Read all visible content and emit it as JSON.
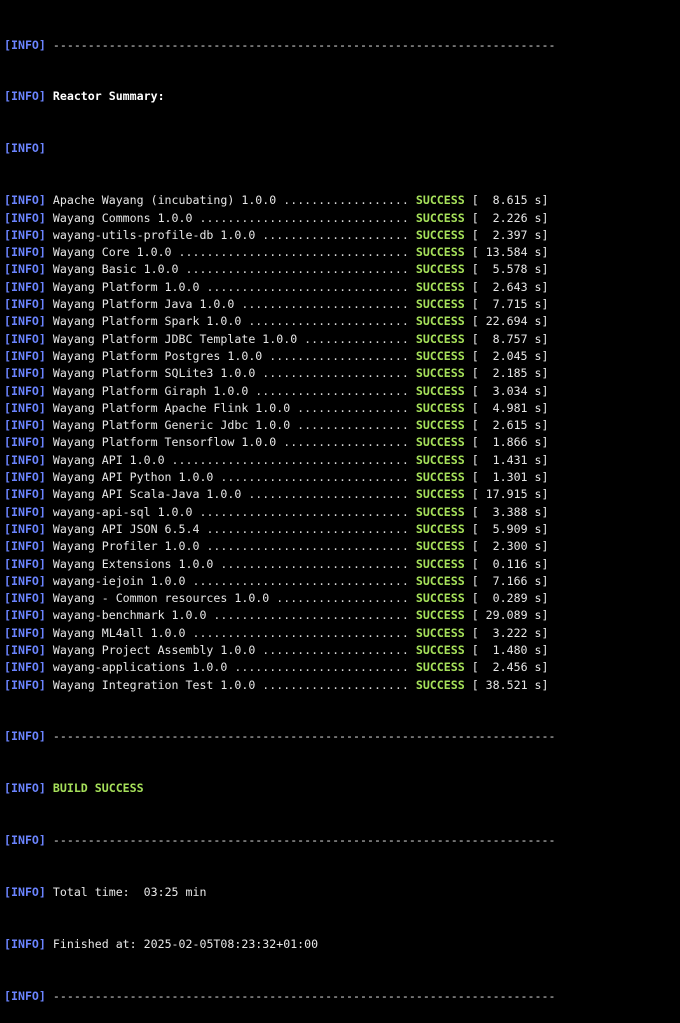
{
  "tag": "[INFO]",
  "separator": "------------------------------------------------------------------------",
  "reactor_summary_title": "Reactor Summary:",
  "modules": [
    {
      "name": "Apache Wayang (incubating) 1.0.0",
      "status": "SUCCESS",
      "time": "8.615 s"
    },
    {
      "name": "Wayang Commons 1.0.0",
      "status": "SUCCESS",
      "time": "2.226 s"
    },
    {
      "name": "wayang-utils-profile-db 1.0.0",
      "status": "SUCCESS",
      "time": "2.397 s"
    },
    {
      "name": "Wayang Core 1.0.0",
      "status": "SUCCESS",
      "time": "13.584 s"
    },
    {
      "name": "Wayang Basic 1.0.0",
      "status": "SUCCESS",
      "time": "5.578 s"
    },
    {
      "name": "Wayang Platform 1.0.0",
      "status": "SUCCESS",
      "time": "2.643 s"
    },
    {
      "name": "Wayang Platform Java 1.0.0",
      "status": "SUCCESS",
      "time": "7.715 s"
    },
    {
      "name": "Wayang Platform Spark 1.0.0",
      "status": "SUCCESS",
      "time": "22.694 s"
    },
    {
      "name": "Wayang Platform JDBC Template 1.0.0",
      "status": "SUCCESS",
      "time": "8.757 s"
    },
    {
      "name": "Wayang Platform Postgres 1.0.0",
      "status": "SUCCESS",
      "time": "2.045 s"
    },
    {
      "name": "Wayang Platform SQLite3 1.0.0",
      "status": "SUCCESS",
      "time": "2.185 s"
    },
    {
      "name": "Wayang Platform Giraph 1.0.0",
      "status": "SUCCESS",
      "time": "3.034 s"
    },
    {
      "name": "Wayang Platform Apache Flink 1.0.0",
      "status": "SUCCESS",
      "time": "4.981 s"
    },
    {
      "name": "Wayang Platform Generic Jdbc 1.0.0",
      "status": "SUCCESS",
      "time": "2.615 s"
    },
    {
      "name": "Wayang Platform Tensorflow 1.0.0",
      "status": "SUCCESS",
      "time": "1.866 s"
    },
    {
      "name": "Wayang API 1.0.0",
      "status": "SUCCESS",
      "time": "1.431 s"
    },
    {
      "name": "Wayang API Python 1.0.0",
      "status": "SUCCESS",
      "time": "1.301 s"
    },
    {
      "name": "Wayang API Scala-Java 1.0.0",
      "status": "SUCCESS",
      "time": "17.915 s"
    },
    {
      "name": "wayang-api-sql 1.0.0",
      "status": "SUCCESS",
      "time": "3.388 s"
    },
    {
      "name": "Wayang API JSON 6.5.4",
      "status": "SUCCESS",
      "time": "5.909 s"
    },
    {
      "name": "Wayang Profiler 1.0.0",
      "status": "SUCCESS",
      "time": "2.300 s"
    },
    {
      "name": "Wayang Extensions 1.0.0",
      "status": "SUCCESS",
      "time": "0.116 s"
    },
    {
      "name": "wayang-iejoin 1.0.0",
      "status": "SUCCESS",
      "time": "7.166 s"
    },
    {
      "name": "Wayang - Common resources 1.0.0",
      "status": "SUCCESS",
      "time": "0.289 s"
    },
    {
      "name": "wayang-benchmark 1.0.0",
      "status": "SUCCESS",
      "time": "29.089 s"
    },
    {
      "name": "Wayang ML4all 1.0.0",
      "status": "SUCCESS",
      "time": "3.222 s"
    },
    {
      "name": "Wayang Project Assembly 1.0.0",
      "status": "SUCCESS",
      "time": "1.480 s"
    },
    {
      "name": "wayang-applications 1.0.0",
      "status": "SUCCESS",
      "time": "2.456 s"
    },
    {
      "name": "Wayang Integration Test 1.0.0",
      "status": "SUCCESS",
      "time": "38.521 s"
    }
  ],
  "build_result": "BUILD SUCCESS",
  "total_time_label": "Total time:",
  "total_time_value": "03:25 min",
  "finished_at_label": "Finished at:",
  "finished_at_value": "2025-02-05T08:23:32+01:00",
  "colors": {
    "background": "#000000",
    "info_tag": "#6b84ff",
    "success": "#a6e05a",
    "text": "#e8e8e8"
  }
}
